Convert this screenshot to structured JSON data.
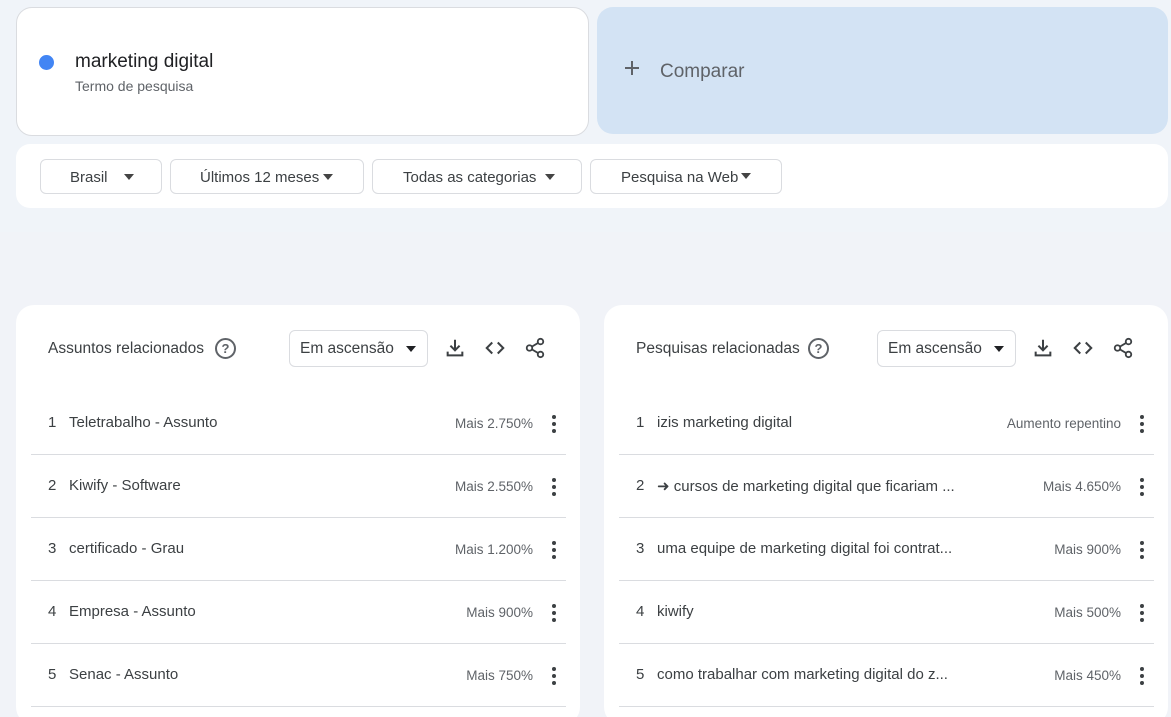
{
  "term": {
    "title": "marketing digital",
    "subtitle": "Termo de pesquisa",
    "color": "#4285f4"
  },
  "compare": {
    "label": "Comparar"
  },
  "filters": {
    "region": "Brasil",
    "period": "Últimos 12 meses",
    "category": "Todas as categorias",
    "search_type": "Pesquisa na Web"
  },
  "related_topics": {
    "title": "Assuntos relacionados",
    "sort": "Em ascensão",
    "rows": [
      {
        "rank": "1",
        "name": "Teletrabalho - Assunto",
        "value": "Mais 2.750%"
      },
      {
        "rank": "2",
        "name": "Kiwify - Software",
        "value": "Mais 2.550%"
      },
      {
        "rank": "3",
        "name": "certificado - Grau",
        "value": "Mais 1.200%"
      },
      {
        "rank": "4",
        "name": "Empresa - Assunto",
        "value": "Mais 900%"
      },
      {
        "rank": "5",
        "name": "Senac - Assunto",
        "value": "Mais 750%"
      }
    ]
  },
  "related_queries": {
    "title": "Pesquisas relacionadas",
    "sort": "Em ascensão",
    "rows": [
      {
        "rank": "1",
        "name": "izis marketing digital",
        "value": "Aumento repentino"
      },
      {
        "rank": "2",
        "name": "➜ cursos de marketing digital que ficariam ...",
        "value": "Mais 4.650%"
      },
      {
        "rank": "3",
        "name": "uma equipe de marketing digital foi contrat...",
        "value": "Mais 900%"
      },
      {
        "rank": "4",
        "name": "kiwify",
        "value": "Mais 500%"
      },
      {
        "rank": "5",
        "name": "como trabalhar com marketing digital do z...",
        "value": "Mais 450%"
      }
    ]
  }
}
